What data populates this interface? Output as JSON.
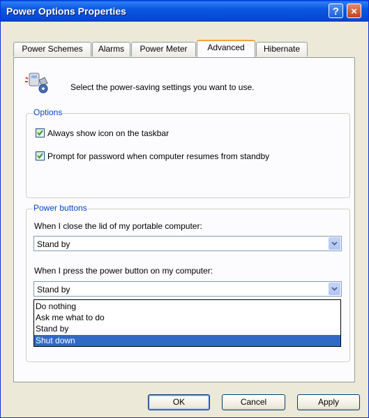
{
  "window": {
    "title": "Power Options Properties",
    "help_label": "?",
    "close_label": "×"
  },
  "tabs": [
    {
      "label": "Power Schemes",
      "active": false
    },
    {
      "label": "Alarms",
      "active": false
    },
    {
      "label": "Power Meter",
      "active": false
    },
    {
      "label": "Advanced",
      "active": true
    },
    {
      "label": "Hibernate",
      "active": false
    }
  ],
  "header": {
    "icon": "power-options-icon",
    "text": "Select the power-saving settings you want to use."
  },
  "options": {
    "label": "Options",
    "always_show_icon": {
      "label": "Always show icon on the taskbar",
      "checked": true
    },
    "prompt_password": {
      "label": "Prompt for password when computer resumes from standby",
      "checked": true
    }
  },
  "power_buttons": {
    "label": "Power buttons",
    "lid_label": "When I close the lid of my portable computer:",
    "lid_value": "Stand by",
    "power_label": "When I press the power button on my computer:",
    "power_value": "Stand by",
    "power_options": [
      "Do nothing",
      "Ask me what to do",
      "Stand by",
      "Shut down"
    ],
    "highlighted_option": "Shut down"
  },
  "buttons": {
    "ok": "OK",
    "cancel": "Cancel",
    "apply": "Apply"
  },
  "colors": {
    "title_bar": "#0a58e0",
    "selection": "#316ac5",
    "group_label": "#0046d5"
  }
}
